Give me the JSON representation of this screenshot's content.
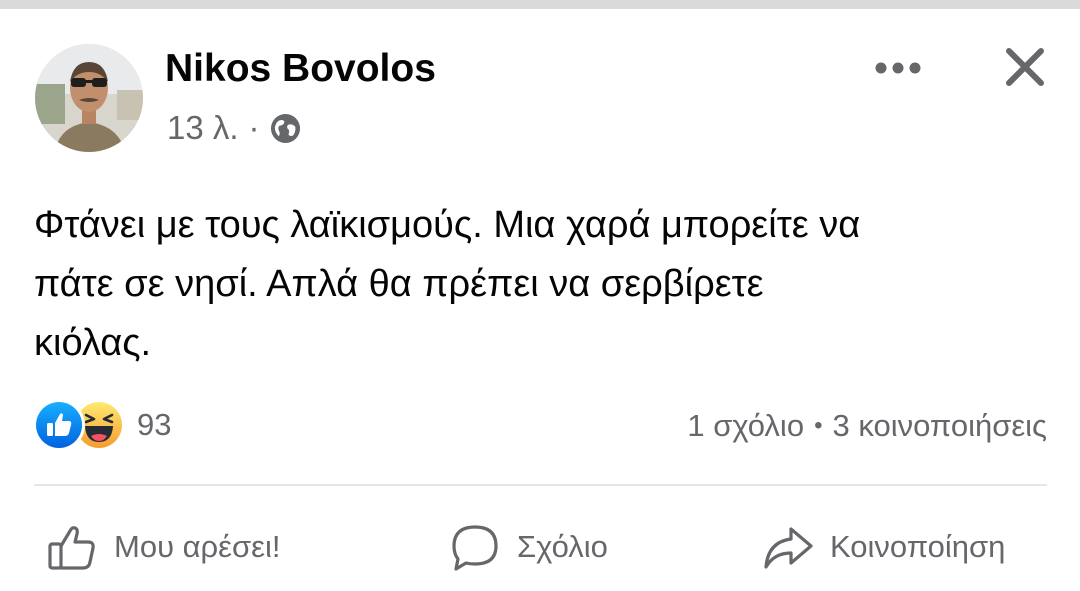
{
  "post": {
    "author": "Nikos Bovolos",
    "time": "13 λ.",
    "separator": "·",
    "audience_icon": "globe-icon",
    "text_lines": [
      "Φτάνει με τους λαϊκισμούς. Μια χαρά μπορείτε να",
      "πάτε σε νησί. Απλά θα πρέπει να σερβίρετε",
      "κιόλας."
    ]
  },
  "header_actions": {
    "more_icon": "more-horizontal-icon",
    "close_icon": "close-icon"
  },
  "reactions": {
    "icons": [
      "like-reaction-icon",
      "haha-reaction-icon"
    ],
    "count": "93"
  },
  "stats": {
    "comments": "1 σχόλιο",
    "dot": "•",
    "shares": "3 κοινοποιήσεις"
  },
  "actions": {
    "like_label": "Μου αρέσει!",
    "comment_label": "Σχόλιο",
    "share_label": "Κοινοποίηση"
  },
  "colors": {
    "like_blue": "#1877f2",
    "haha_yellow": "#f7b928",
    "secondary_text": "#65676b",
    "divider": "#e4e6eb"
  }
}
